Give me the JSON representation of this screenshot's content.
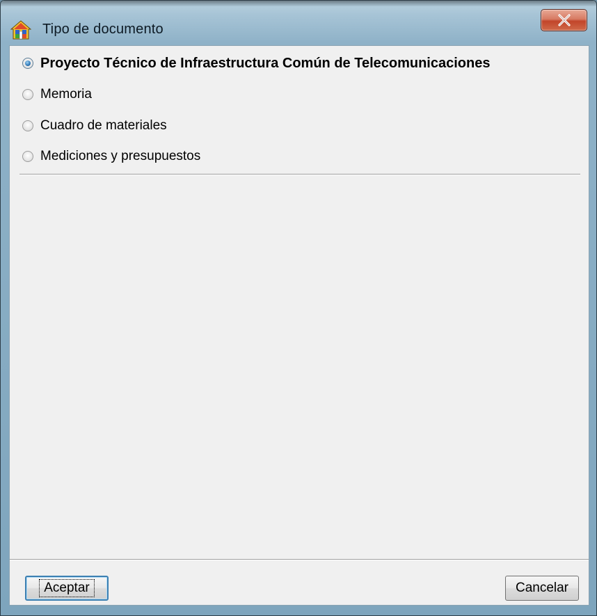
{
  "window": {
    "title": "Tipo de documento",
    "close_label": "X",
    "app_icon": "house-icon"
  },
  "options": [
    {
      "label": "Proyecto Técnico de Infraestructura Común de Telecomunicaciones",
      "checked": true
    },
    {
      "label": "Memoria",
      "checked": false
    },
    {
      "label": "Cuadro de materiales",
      "checked": false
    },
    {
      "label": "Mediciones y presupuestos",
      "checked": false
    }
  ],
  "buttons": {
    "accept_label": "Aceptar",
    "cancel_label": "Cancelar"
  },
  "colors": {
    "accent": "#3c7fb1",
    "close_red": "#c2452a"
  }
}
